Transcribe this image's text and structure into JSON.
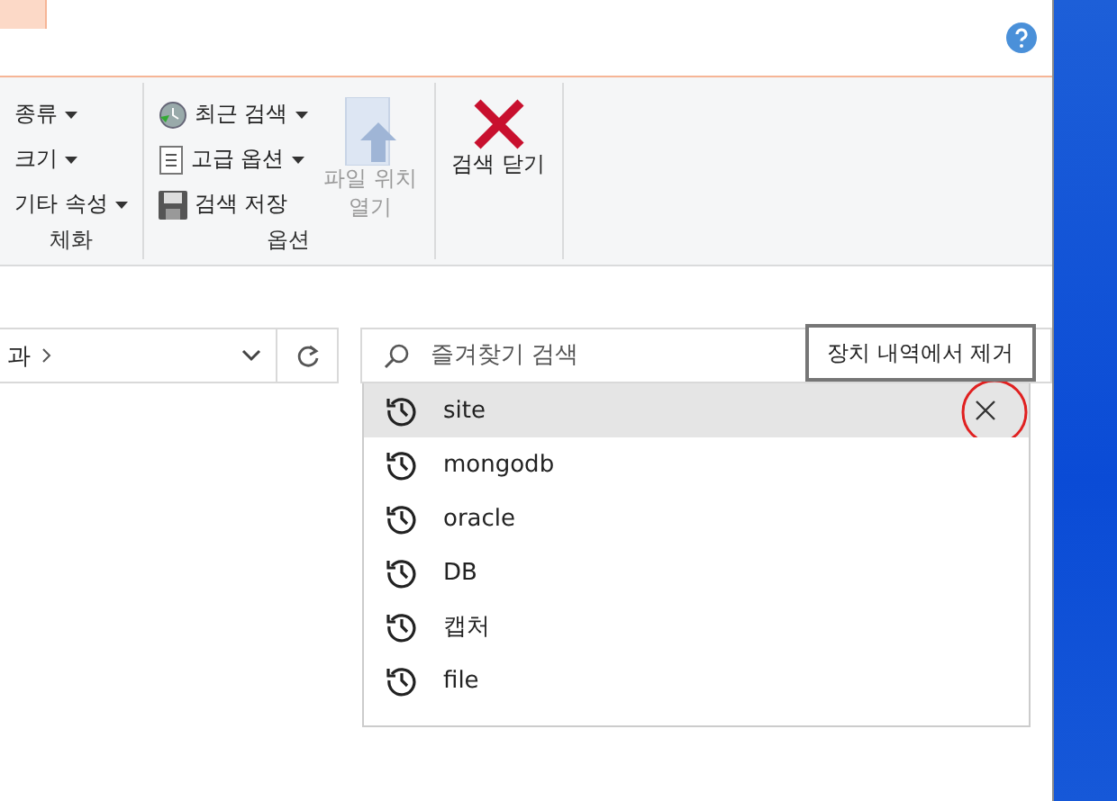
{
  "ribbon": {
    "groups": [
      {
        "label": "체화",
        "small_items": [
          {
            "label": "종류",
            "has_menu": true
          },
          {
            "label": "크기",
            "has_menu": true
          },
          {
            "label": "기타 속성",
            "has_menu": true
          }
        ]
      },
      {
        "label": "옵션",
        "small_items": [
          {
            "label": "최근 검색",
            "has_menu": true,
            "kind": "recent"
          },
          {
            "label": "고급 옵션",
            "has_menu": true,
            "kind": "advanced"
          },
          {
            "label": "검색 저장",
            "has_menu": false,
            "kind": "save"
          }
        ],
        "large_items": [
          {
            "label": "파일 위치 열기",
            "kind": "open-location",
            "disabled": true
          }
        ]
      },
      {
        "large_items": [
          {
            "label": "검색 닫기",
            "kind": "close",
            "disabled": false
          }
        ]
      }
    ]
  },
  "address": {
    "crumb": "과"
  },
  "search": {
    "placeholder": "즐겨찾기 검색"
  },
  "tooltip": "장치 내역에서 제거",
  "history": [
    {
      "label": "site",
      "selected": true
    },
    {
      "label": "mongodb",
      "selected": false
    },
    {
      "label": "oracle",
      "selected": false
    },
    {
      "label": "DB",
      "selected": false
    },
    {
      "label": "캡처",
      "selected": false
    },
    {
      "label": "file",
      "selected": false
    }
  ]
}
